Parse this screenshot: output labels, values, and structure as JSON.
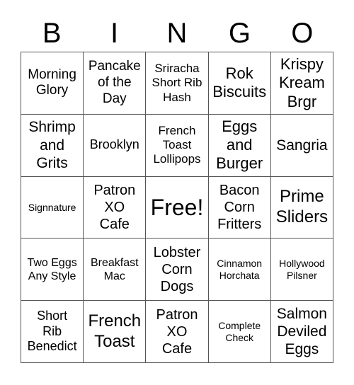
{
  "header": [
    "B",
    "I",
    "N",
    "G",
    "O"
  ],
  "cells": [
    [
      "Morning\nGlory",
      "Pancake\nof the\nDay",
      "Sriracha\nShort Rib\nHash",
      "Rok\nBiscuits",
      "Krispy\nKream\nBrgr"
    ],
    [
      "Shrimp\nand\nGrits",
      "Brooklyn",
      "French\nToast\nLollipops",
      "Eggs\nand\nBurger",
      "Sangria"
    ],
    [
      "Signnature",
      "Patron\nXO\nCafe",
      "Free!",
      "Bacon\nCorn\nFritters",
      "Prime\nSliders"
    ],
    [
      "Two Eggs\nAny Style",
      "Breakfast\nMac",
      "Lobster\nCorn\nDogs",
      "Cinnamon\nHorchata",
      "Hollywood\nPilsner"
    ],
    [
      "Short\nRib\nBenedict",
      "French\nToast",
      "Patron\nXO\nCafe",
      "Complete\nCheck",
      "Salmon\nDeviled\nEggs"
    ]
  ]
}
